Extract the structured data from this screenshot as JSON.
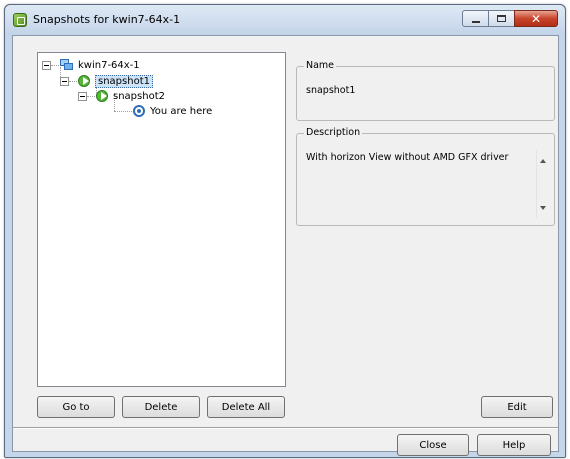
{
  "window": {
    "title": "Snapshots for kwin7-64x-1",
    "controls": {
      "minimize": "minimize",
      "maximize": "maximize",
      "close": "✕"
    }
  },
  "tree": {
    "root": "kwin7-64x-1",
    "snapshot1": "snapshot1",
    "snapshot2": "snapshot2",
    "current": "You are here",
    "selected": "snapshot1"
  },
  "details": {
    "name_legend": "Name",
    "name_value": "snapshot1",
    "description_legend": "Description",
    "description_value": "With horizon View without AMD GFX driver"
  },
  "buttons": {
    "goto": "Go to",
    "delete": "Delete",
    "delete_all": "Delete All",
    "edit": "Edit",
    "close": "Close",
    "help": "Help"
  },
  "icons": {
    "app": "snapshot-manager-icon",
    "vm": "virtual-machine-icon",
    "snapshot": "snapshot-icon",
    "current": "current-state-icon"
  }
}
